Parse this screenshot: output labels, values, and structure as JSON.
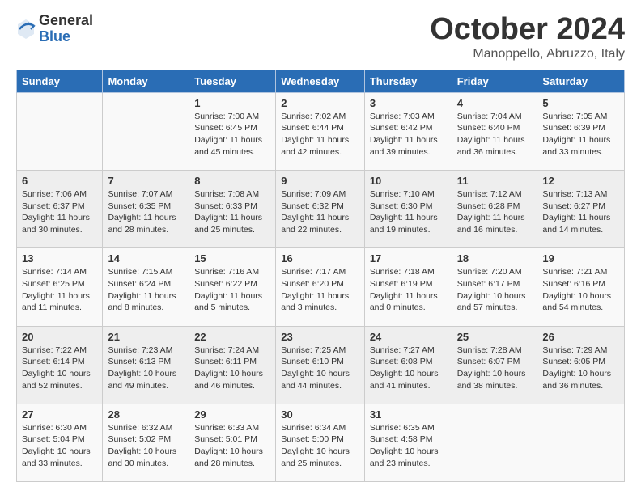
{
  "header": {
    "logo": {
      "general": "General",
      "blue": "Blue"
    },
    "title": "October 2024",
    "location": "Manoppello, Abruzzo, Italy"
  },
  "weekdays": [
    "Sunday",
    "Monday",
    "Tuesday",
    "Wednesday",
    "Thursday",
    "Friday",
    "Saturday"
  ],
  "weeks": [
    [
      {
        "day": "",
        "sunrise": "",
        "sunset": "",
        "daylight": ""
      },
      {
        "day": "",
        "sunrise": "",
        "sunset": "",
        "daylight": ""
      },
      {
        "day": "1",
        "sunrise": "Sunrise: 7:00 AM",
        "sunset": "Sunset: 6:45 PM",
        "daylight": "Daylight: 11 hours and 45 minutes."
      },
      {
        "day": "2",
        "sunrise": "Sunrise: 7:02 AM",
        "sunset": "Sunset: 6:44 PM",
        "daylight": "Daylight: 11 hours and 42 minutes."
      },
      {
        "day": "3",
        "sunrise": "Sunrise: 7:03 AM",
        "sunset": "Sunset: 6:42 PM",
        "daylight": "Daylight: 11 hours and 39 minutes."
      },
      {
        "day": "4",
        "sunrise": "Sunrise: 7:04 AM",
        "sunset": "Sunset: 6:40 PM",
        "daylight": "Daylight: 11 hours and 36 minutes."
      },
      {
        "day": "5",
        "sunrise": "Sunrise: 7:05 AM",
        "sunset": "Sunset: 6:39 PM",
        "daylight": "Daylight: 11 hours and 33 minutes."
      }
    ],
    [
      {
        "day": "6",
        "sunrise": "Sunrise: 7:06 AM",
        "sunset": "Sunset: 6:37 PM",
        "daylight": "Daylight: 11 hours and 30 minutes."
      },
      {
        "day": "7",
        "sunrise": "Sunrise: 7:07 AM",
        "sunset": "Sunset: 6:35 PM",
        "daylight": "Daylight: 11 hours and 28 minutes."
      },
      {
        "day": "8",
        "sunrise": "Sunrise: 7:08 AM",
        "sunset": "Sunset: 6:33 PM",
        "daylight": "Daylight: 11 hours and 25 minutes."
      },
      {
        "day": "9",
        "sunrise": "Sunrise: 7:09 AM",
        "sunset": "Sunset: 6:32 PM",
        "daylight": "Daylight: 11 hours and 22 minutes."
      },
      {
        "day": "10",
        "sunrise": "Sunrise: 7:10 AM",
        "sunset": "Sunset: 6:30 PM",
        "daylight": "Daylight: 11 hours and 19 minutes."
      },
      {
        "day": "11",
        "sunrise": "Sunrise: 7:12 AM",
        "sunset": "Sunset: 6:28 PM",
        "daylight": "Daylight: 11 hours and 16 minutes."
      },
      {
        "day": "12",
        "sunrise": "Sunrise: 7:13 AM",
        "sunset": "Sunset: 6:27 PM",
        "daylight": "Daylight: 11 hours and 14 minutes."
      }
    ],
    [
      {
        "day": "13",
        "sunrise": "Sunrise: 7:14 AM",
        "sunset": "Sunset: 6:25 PM",
        "daylight": "Daylight: 11 hours and 11 minutes."
      },
      {
        "day": "14",
        "sunrise": "Sunrise: 7:15 AM",
        "sunset": "Sunset: 6:24 PM",
        "daylight": "Daylight: 11 hours and 8 minutes."
      },
      {
        "day": "15",
        "sunrise": "Sunrise: 7:16 AM",
        "sunset": "Sunset: 6:22 PM",
        "daylight": "Daylight: 11 hours and 5 minutes."
      },
      {
        "day": "16",
        "sunrise": "Sunrise: 7:17 AM",
        "sunset": "Sunset: 6:20 PM",
        "daylight": "Daylight: 11 hours and 3 minutes."
      },
      {
        "day": "17",
        "sunrise": "Sunrise: 7:18 AM",
        "sunset": "Sunset: 6:19 PM",
        "daylight": "Daylight: 11 hours and 0 minutes."
      },
      {
        "day": "18",
        "sunrise": "Sunrise: 7:20 AM",
        "sunset": "Sunset: 6:17 PM",
        "daylight": "Daylight: 10 hours and 57 minutes."
      },
      {
        "day": "19",
        "sunrise": "Sunrise: 7:21 AM",
        "sunset": "Sunset: 6:16 PM",
        "daylight": "Daylight: 10 hours and 54 minutes."
      }
    ],
    [
      {
        "day": "20",
        "sunrise": "Sunrise: 7:22 AM",
        "sunset": "Sunset: 6:14 PM",
        "daylight": "Daylight: 10 hours and 52 minutes."
      },
      {
        "day": "21",
        "sunrise": "Sunrise: 7:23 AM",
        "sunset": "Sunset: 6:13 PM",
        "daylight": "Daylight: 10 hours and 49 minutes."
      },
      {
        "day": "22",
        "sunrise": "Sunrise: 7:24 AM",
        "sunset": "Sunset: 6:11 PM",
        "daylight": "Daylight: 10 hours and 46 minutes."
      },
      {
        "day": "23",
        "sunrise": "Sunrise: 7:25 AM",
        "sunset": "Sunset: 6:10 PM",
        "daylight": "Daylight: 10 hours and 44 minutes."
      },
      {
        "day": "24",
        "sunrise": "Sunrise: 7:27 AM",
        "sunset": "Sunset: 6:08 PM",
        "daylight": "Daylight: 10 hours and 41 minutes."
      },
      {
        "day": "25",
        "sunrise": "Sunrise: 7:28 AM",
        "sunset": "Sunset: 6:07 PM",
        "daylight": "Daylight: 10 hours and 38 minutes."
      },
      {
        "day": "26",
        "sunrise": "Sunrise: 7:29 AM",
        "sunset": "Sunset: 6:05 PM",
        "daylight": "Daylight: 10 hours and 36 minutes."
      }
    ],
    [
      {
        "day": "27",
        "sunrise": "Sunrise: 6:30 AM",
        "sunset": "Sunset: 5:04 PM",
        "daylight": "Daylight: 10 hours and 33 minutes."
      },
      {
        "day": "28",
        "sunrise": "Sunrise: 6:32 AM",
        "sunset": "Sunset: 5:02 PM",
        "daylight": "Daylight: 10 hours and 30 minutes."
      },
      {
        "day": "29",
        "sunrise": "Sunrise: 6:33 AM",
        "sunset": "Sunset: 5:01 PM",
        "daylight": "Daylight: 10 hours and 28 minutes."
      },
      {
        "day": "30",
        "sunrise": "Sunrise: 6:34 AM",
        "sunset": "Sunset: 5:00 PM",
        "daylight": "Daylight: 10 hours and 25 minutes."
      },
      {
        "day": "31",
        "sunrise": "Sunrise: 6:35 AM",
        "sunset": "Sunset: 4:58 PM",
        "daylight": "Daylight: 10 hours and 23 minutes."
      },
      {
        "day": "",
        "sunrise": "",
        "sunset": "",
        "daylight": ""
      },
      {
        "day": "",
        "sunrise": "",
        "sunset": "",
        "daylight": ""
      }
    ]
  ]
}
